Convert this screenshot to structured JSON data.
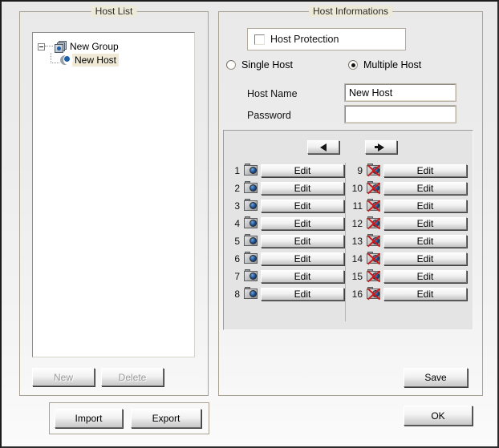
{
  "window": {
    "background_color": "#ececec",
    "border_color": "#1c1c1c"
  },
  "host_list": {
    "title": "Host List",
    "tree": [
      {
        "label": "New Group",
        "icon": "group-stack-icon",
        "expander": "minus",
        "selected": false
      },
      {
        "label": "New Host",
        "icon": "host-icon",
        "selected": true
      }
    ],
    "new_button": {
      "label": "New",
      "enabled": false
    },
    "delete_button": {
      "label": "Delete",
      "enabled": false
    }
  },
  "import_export": {
    "import_button": "Import",
    "export_button": "Export"
  },
  "host_information": {
    "title": "Host Informations",
    "host_protection": {
      "label": "Host Protection",
      "checked": false
    },
    "mode": {
      "single": {
        "label": "Single Host",
        "selected": false
      },
      "multiple": {
        "label": "Multiple Host",
        "selected": true
      }
    },
    "host_name": {
      "label": "Host Name",
      "value": "New Host",
      "placeholder": ""
    },
    "password": {
      "label": "Password",
      "value": "",
      "placeholder": ""
    },
    "pager": {
      "prev_icon": "left-arrow-icon",
      "next_icon": "right-arrow-icon"
    },
    "channels_left": [
      {
        "number": "1",
        "icon": "camera-icon",
        "enabled": true,
        "edit_label": "Edit"
      },
      {
        "number": "2",
        "icon": "camera-icon",
        "enabled": true,
        "edit_label": "Edit"
      },
      {
        "number": "3",
        "icon": "camera-icon",
        "enabled": true,
        "edit_label": "Edit"
      },
      {
        "number": "4",
        "icon": "camera-icon",
        "enabled": true,
        "edit_label": "Edit"
      },
      {
        "number": "5",
        "icon": "camera-icon",
        "enabled": true,
        "edit_label": "Edit"
      },
      {
        "number": "6",
        "icon": "camera-icon",
        "enabled": true,
        "edit_label": "Edit"
      },
      {
        "number": "7",
        "icon": "camera-icon",
        "enabled": true,
        "edit_label": "Edit"
      },
      {
        "number": "8",
        "icon": "camera-icon",
        "enabled": true,
        "edit_label": "Edit"
      }
    ],
    "channels_right": [
      {
        "number": "9",
        "icon": "camera-disabled-icon",
        "enabled": false,
        "edit_label": "Edit"
      },
      {
        "number": "10",
        "icon": "camera-disabled-icon",
        "enabled": false,
        "edit_label": "Edit"
      },
      {
        "number": "11",
        "icon": "camera-disabled-icon",
        "enabled": false,
        "edit_label": "Edit"
      },
      {
        "number": "12",
        "icon": "camera-disabled-icon",
        "enabled": false,
        "edit_label": "Edit"
      },
      {
        "number": "13",
        "icon": "camera-disabled-icon",
        "enabled": false,
        "edit_label": "Edit"
      },
      {
        "number": "14",
        "icon": "camera-disabled-icon",
        "enabled": false,
        "edit_label": "Edit"
      },
      {
        "number": "15",
        "icon": "camera-disabled-icon",
        "enabled": false,
        "edit_label": "Edit"
      },
      {
        "number": "16",
        "icon": "camera-disabled-icon",
        "enabled": false,
        "edit_label": "Edit"
      }
    ],
    "save_button": "Save"
  },
  "dialog": {
    "ok_button": "OK"
  }
}
